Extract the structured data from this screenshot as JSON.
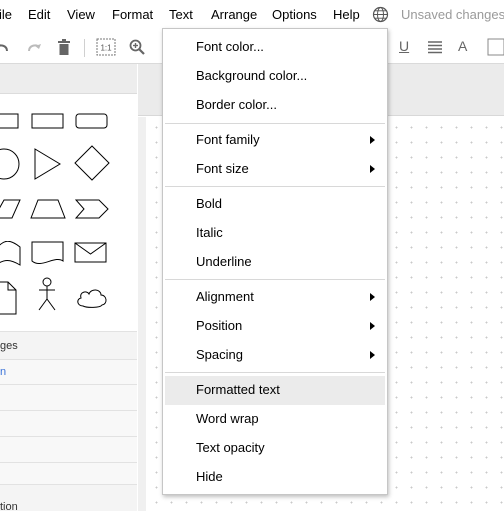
{
  "menubar": {
    "items": [
      "ile",
      "Edit",
      "View",
      "Format",
      "Text",
      "Arrange",
      "Options",
      "Help"
    ],
    "status": "Unsaved changes"
  },
  "toolbar": {
    "actual_size_label": "1:1",
    "underline_label": "U",
    "font_color_label": "A"
  },
  "sidebar": {
    "sections": [
      "ges",
      "n",
      "tion"
    ]
  },
  "text_menu": {
    "items": [
      {
        "label": "Font color...",
        "submenu": false
      },
      {
        "label": "Background color...",
        "submenu": false
      },
      {
        "label": "Border color...",
        "submenu": false
      },
      {
        "label": "Font family",
        "submenu": true
      },
      {
        "label": "Font size",
        "submenu": true
      },
      {
        "label": "Bold",
        "submenu": false
      },
      {
        "label": "Italic",
        "submenu": false
      },
      {
        "label": "Underline",
        "submenu": false
      },
      {
        "label": "Alignment",
        "submenu": true
      },
      {
        "label": "Position",
        "submenu": true
      },
      {
        "label": "Spacing",
        "submenu": true
      },
      {
        "label": "Formatted text",
        "submenu": false,
        "highlighted": true
      },
      {
        "label": "Word wrap",
        "submenu": false
      },
      {
        "label": "Text opacity",
        "submenu": false
      },
      {
        "label": "Hide",
        "submenu": false
      }
    ]
  },
  "colors": {
    "highlight": "#ebebeb",
    "status_text": "#9a9a9a",
    "link_blue": "#3b73d9"
  }
}
